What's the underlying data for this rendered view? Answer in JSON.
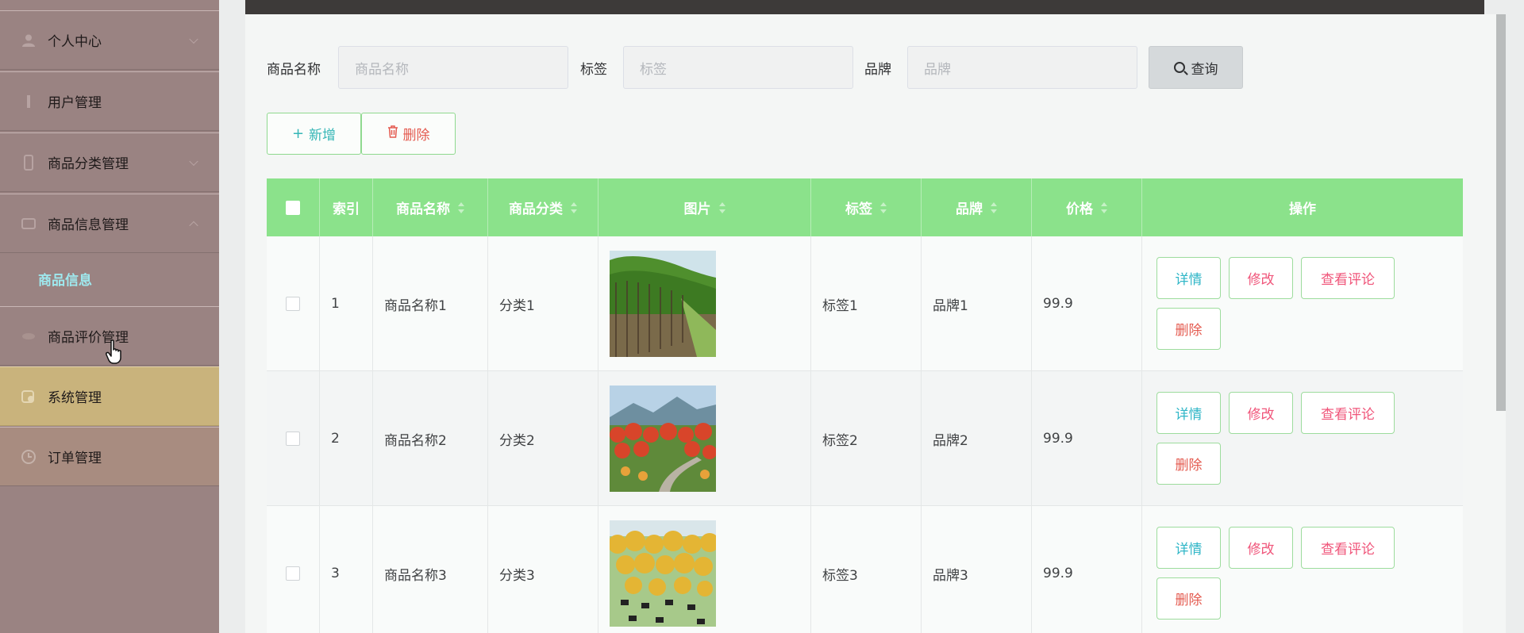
{
  "sidebar": {
    "items": [
      {
        "label": "个人中心",
        "icon": "person-icon"
      },
      {
        "label": "用户管理",
        "icon": "user-manage-icon"
      },
      {
        "label": "商品分类管理",
        "icon": "category-icon"
      },
      {
        "label": "商品信息管理",
        "icon": "product-icon"
      },
      {
        "label": "商品评价管理",
        "icon": "review-icon"
      },
      {
        "label": "系统管理",
        "icon": "system-icon"
      },
      {
        "label": "订单管理",
        "icon": "order-icon"
      }
    ],
    "sub_item": "商品信息"
  },
  "search": {
    "name_label": "商品名称",
    "name_placeholder": "商品名称",
    "tag_label": "标签",
    "tag_placeholder": "标签",
    "brand_label": "品牌",
    "brand_placeholder": "品牌",
    "query_label": "查询"
  },
  "toolbar": {
    "add_label": "新增",
    "delete_label": "删除"
  },
  "table": {
    "headers": [
      "索引",
      "商品名称",
      "商品分类",
      "图片",
      "标签",
      "品牌",
      "价格",
      "操作"
    ],
    "rows": [
      {
        "index": "1",
        "name": "商品名称1",
        "category": "分类1",
        "tag": "标签1",
        "brand": "品牌1",
        "price": "99.9"
      },
      {
        "index": "2",
        "name": "商品名称2",
        "category": "分类2",
        "tag": "标签2",
        "brand": "品牌2",
        "price": "99.9"
      },
      {
        "index": "3",
        "name": "商品名称3",
        "category": "分类3",
        "tag": "标签3",
        "brand": "品牌3",
        "price": "99.9"
      }
    ],
    "actions": {
      "detail": "详情",
      "edit": "修改",
      "view_reviews": "查看评论",
      "delete": "删除"
    }
  },
  "colors": {
    "sidebar_bg": "#9a8382",
    "sidebar_active_sub": "#9ee8ee",
    "header_green": "#8be28b",
    "action_blue": "#2fb6c7",
    "action_pink": "#f0557a",
    "action_red": "#e45a4f"
  }
}
